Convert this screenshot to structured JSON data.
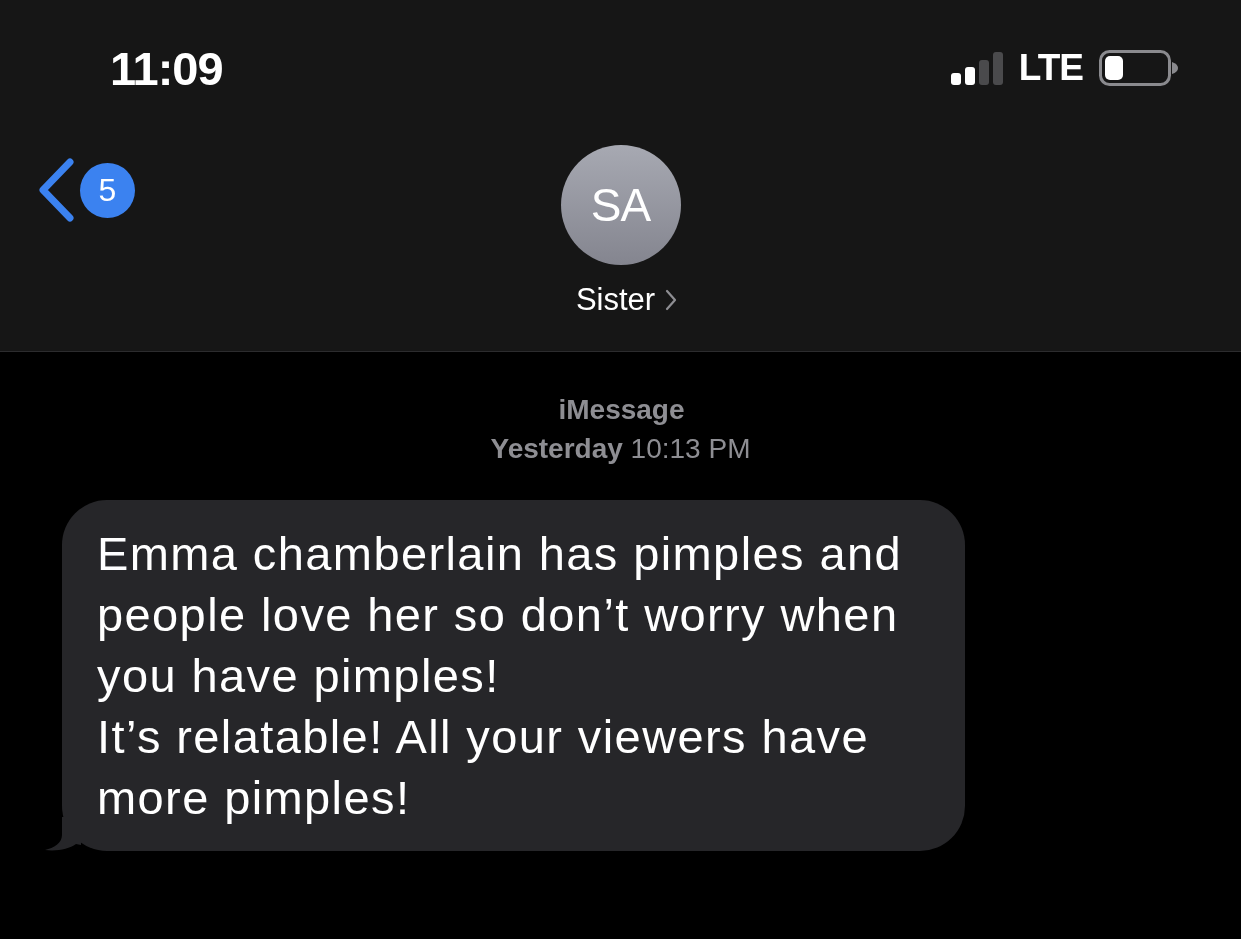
{
  "status_bar": {
    "time": "11:09",
    "network": "LTE"
  },
  "header": {
    "back_badge": "5",
    "contact": {
      "initials": "SA",
      "name": "Sister"
    }
  },
  "conversation": {
    "service": "iMessage",
    "timestamp": "**Yesterday** 10:13 PM",
    "messages": [
      {
        "kind": "received",
        "text": "Emma chamberlain has pimples and people love her so don’t worry when you have pimples!\nIt’s relatable! All your viewers have more pimples!"
      }
    ]
  }
}
